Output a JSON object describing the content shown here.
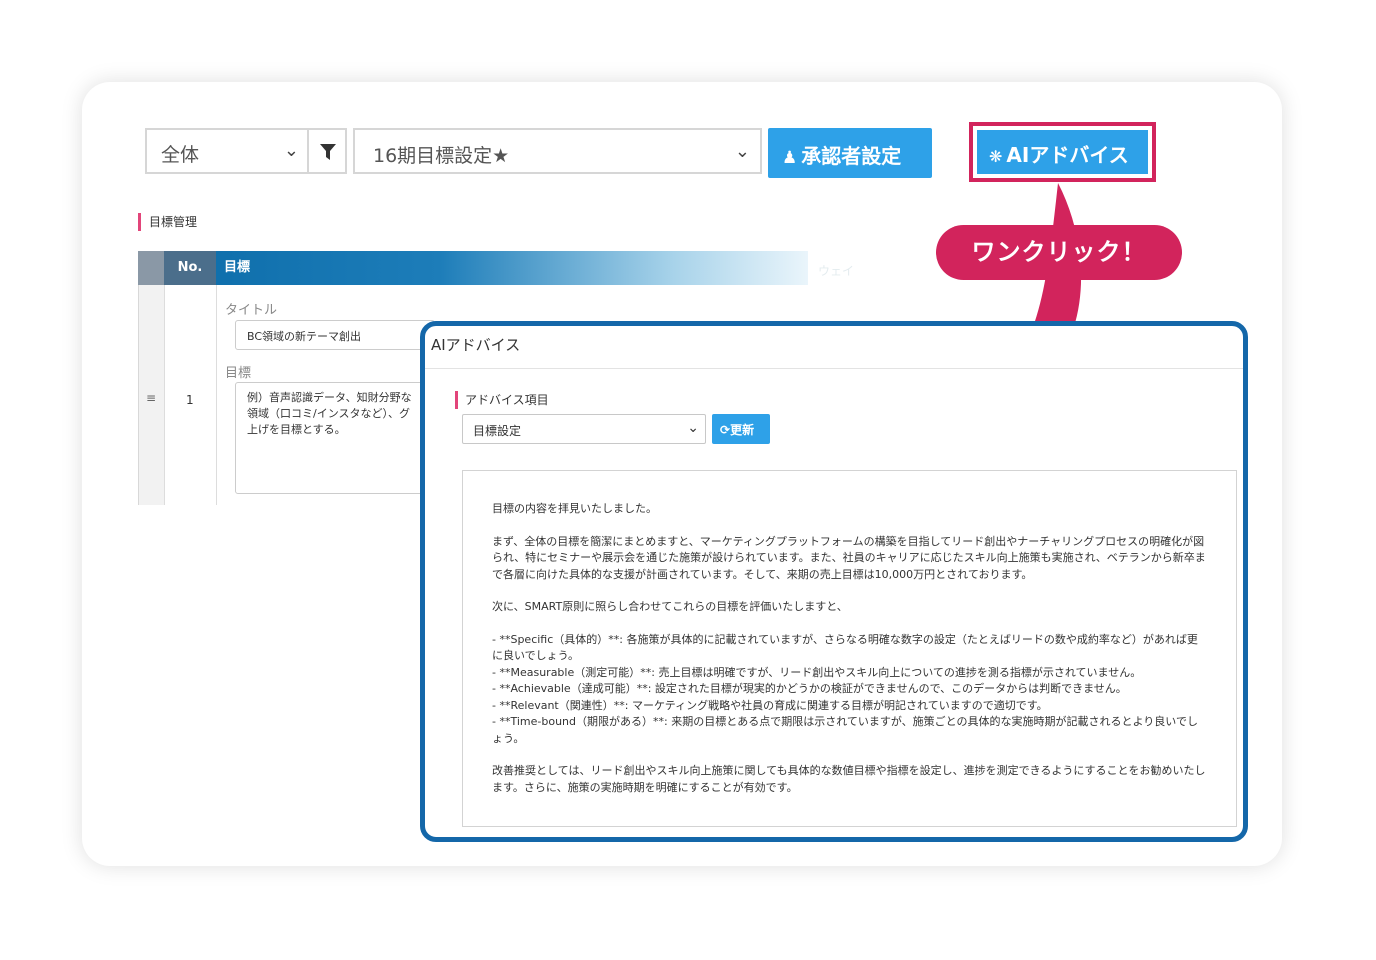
{
  "toolbar": {
    "scope_select": "全体",
    "period_select": "16期目標設定★",
    "approver_label": "承認者設定",
    "ai_label": "AIアドバイス"
  },
  "section": {
    "title": "目標管理"
  },
  "table": {
    "col_no": "No.",
    "col_goal": "目標",
    "col_weight": "ウェイ",
    "row": {
      "handle": "≡",
      "no": "1",
      "title_label": "タイトル",
      "title_value": "BC領域の新テーマ創出",
      "goal_label": "目標",
      "goal_value": "例）音声認識データ、知財分野な\n領域（口コミ/インスタなど）、グ\n上げを目標とする。"
    }
  },
  "callout": {
    "text": "ワンクリック！"
  },
  "modal": {
    "title": "AIアドバイス",
    "advice_item_label": "アドバイス項目",
    "advice_select": "目標設定",
    "refresh_label": "更新",
    "paragraphs": [
      "目標の内容を拝見いたしました。",
      "まず、全体の目標を簡潔にまとめますと、マーケティングプラットフォームの構築を目指してリード創出やナーチャリングプロセスの明確化が図られ、特にセミナーや展示会を通じた施策が設けられています。また、社員のキャリアに応じたスキル向上施策も実施され、ベテランから新卒まで各層に向けた具体的な支援が計画されています。そして、来期の売上目標は10,000万円とされております。",
      "次に、SMART原則に照らし合わせてこれらの目標を評価いたしますと、",
      "- **Specific（具体的）**: 各施策が具体的に記載されていますが、さらなる明確な数字の設定（たとえばリードの数や成約率など）があれば更に良いでしょう。\n- **Measurable（測定可能）**: 売上目標は明確ですが、リード創出やスキル向上についての進捗を測る指標が示されていません。\n- **Achievable（達成可能）**: 設定された目標が現実的かどうかの検証ができませんので、このデータからは判断できません。\n- **Relevant（関連性）**: マーケティング戦略や社員の育成に関連する目標が明記されていますので適切です。\n- **Time-bound（期限がある）**: 来期の目標とある点で期限は示されていますが、施策ごとの具体的な実施時期が記載されるとより良いでしょう。",
      "改善推奨としては、リード創出やスキル向上施策に関しても具体的な数値目標や指標を設定し、進捗を測定できるようにすることをお勧めいたします。さらに、施策の実施時期を明確にすることが有効です。"
    ]
  },
  "colors": {
    "accent_pink": "#d2245c",
    "button_blue": "#2ea1e8",
    "modal_border": "#1467a9",
    "header_blue": "#0b6ba8"
  },
  "icons": {
    "filter": "filter-icon",
    "approver": "users-icon",
    "ai": "brain-icon",
    "refresh": "refresh-icon"
  }
}
